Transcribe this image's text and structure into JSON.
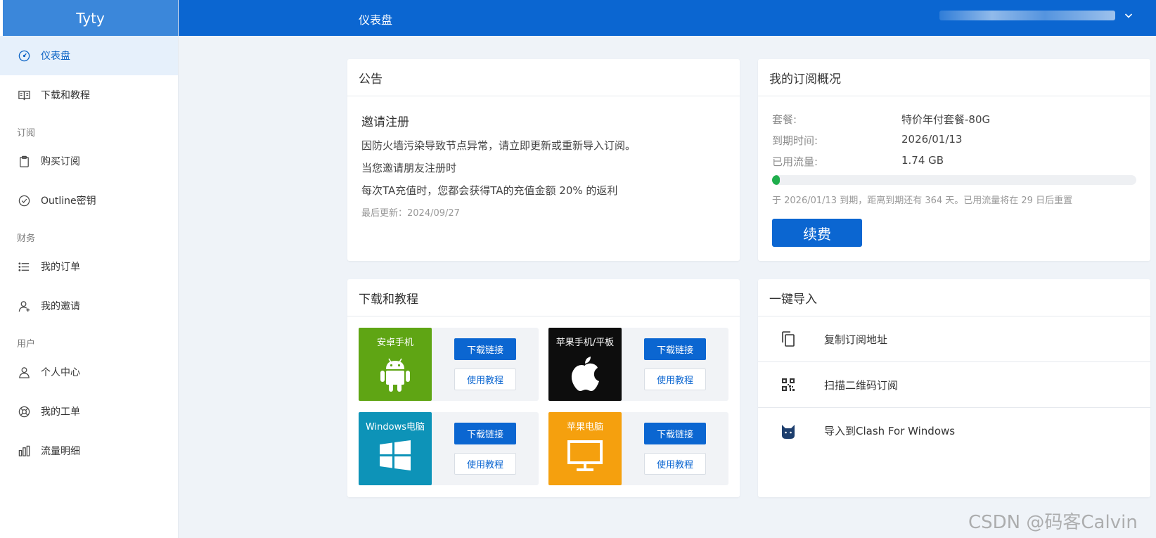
{
  "app": {
    "name": "Tyty"
  },
  "header": {
    "title": "仪表盘"
  },
  "sidebar": {
    "items": [
      {
        "label": "仪表盘",
        "icon": "dashboard-icon"
      },
      {
        "label": "下载和教程",
        "icon": "book-icon"
      },
      {
        "group": "订阅"
      },
      {
        "label": "购买订阅",
        "icon": "clipboard-icon"
      },
      {
        "label": "Outline密钥",
        "icon": "check-circle-icon"
      },
      {
        "group": "财务"
      },
      {
        "label": "我的订单",
        "icon": "list-icon"
      },
      {
        "label": "我的邀请",
        "icon": "user-add-icon"
      },
      {
        "group": "用户"
      },
      {
        "label": "个人中心",
        "icon": "user-icon"
      },
      {
        "label": "我的工单",
        "icon": "lifebuoy-icon"
      },
      {
        "label": "流量明细",
        "icon": "bar-chart-icon"
      }
    ]
  },
  "notice": {
    "title": "公告",
    "heading": "邀请注册",
    "lines": [
      "因防火墙污染导致节点异常，请立即更新或重新导入订阅。",
      "当您邀请朋友注册时",
      "每次TA充值时，您都会获得TA的充值金额 20% 的返利"
    ],
    "updated": "最后更新：2024/09/27"
  },
  "subscription": {
    "title": "我的订阅概况",
    "rows": [
      {
        "label": "套餐:",
        "value": "特价年付套餐-80G"
      },
      {
        "label": "到期时间:",
        "value": "2026/01/13"
      },
      {
        "label": "已用流量:",
        "value": "1.74 GB"
      }
    ],
    "usage_fraction": 0.022,
    "note": "于 2026/01/13 到期，距离到期还有 364 天。已用流量将在 29 日后重置",
    "renew_label": "续费",
    "colors": {
      "progress": "#1fae4c"
    }
  },
  "downloads": {
    "title": "下载和教程",
    "items": [
      {
        "name": "安卓手机",
        "color": "#5fa514",
        "icon": "android-icon",
        "download": "下载链接",
        "tutorial": "使用教程"
      },
      {
        "name": "苹果手机/平板",
        "color": "#0d0d0d",
        "icon": "apple-icon",
        "download": "下载链接",
        "tutorial": "使用教程"
      },
      {
        "name": "Windows电脑",
        "color": "#0d93b8",
        "icon": "windows-icon",
        "download": "下载链接",
        "tutorial": "使用教程"
      },
      {
        "name": "苹果电脑",
        "color": "#f5a00e",
        "icon": "monitor-icon",
        "download": "下载链接",
        "tutorial": "使用教程"
      }
    ]
  },
  "import": {
    "title": "一键导入",
    "items": [
      {
        "label": "复制订阅地址",
        "icon": "copy-icon"
      },
      {
        "label": "扫描二维码订阅",
        "icon": "qrcode-icon"
      },
      {
        "label": "导入到Clash For Windows",
        "icon": "cat-icon"
      }
    ]
  },
  "watermark": "CSDN @码客Calvin",
  "theme": {
    "primary": "#0b66d1",
    "header": "#0b66d1",
    "logo_bg": "#3b87da"
  }
}
